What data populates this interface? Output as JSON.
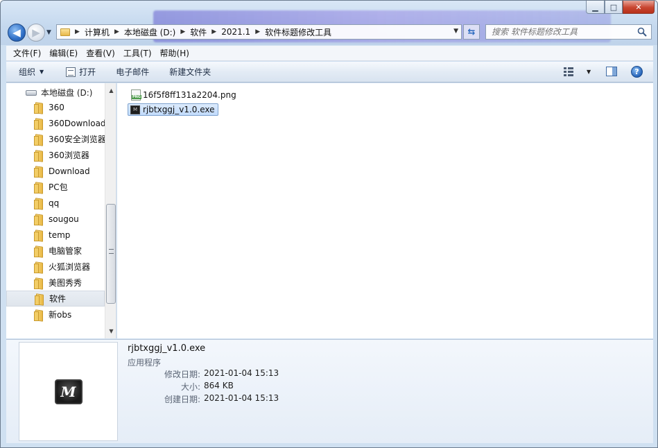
{
  "window": {
    "controls": {
      "minimize": "▁",
      "maximize": "□",
      "close": "✕"
    }
  },
  "nav": {
    "back_glyph": "◀",
    "forward_glyph": "▶",
    "address": [
      "计算机",
      "本地磁盘 (D:)",
      "软件",
      "2021.1",
      "软件标题修改工具"
    ],
    "search_placeholder": "搜索 软件标题修改工具"
  },
  "menubar": [
    "文件(F)",
    "编辑(E)",
    "查看(V)",
    "工具(T)",
    "帮助(H)"
  ],
  "commandbar": {
    "organize": "组织",
    "open": "打开",
    "email": "电子邮件",
    "new_folder": "新建文件夹"
  },
  "navpane": {
    "drive": "本地磁盘 (D:)",
    "folders": [
      "360",
      "360Download",
      "360安全浏览器",
      "360浏览器",
      "Download",
      "PC包",
      "qq",
      "sougou",
      "temp",
      "电脑管家",
      "火狐浏览器",
      "美图秀秀",
      "软件",
      "新obs"
    ],
    "selected_folder": "软件"
  },
  "files": [
    {
      "name": "16f5f8ff131a2204.png",
      "type": "png",
      "selected": false
    },
    {
      "name": "rjbtxggj_v1.0.exe",
      "type": "exe",
      "selected": true
    }
  ],
  "details": {
    "name": "rjbtxggj_v1.0.exe",
    "type": "应用程序",
    "rows": [
      {
        "label": "修改日期:",
        "value": "2021-01-04 15:13"
      },
      {
        "label": "大小:",
        "value": "864 KB"
      },
      {
        "label": "创建日期:",
        "value": "2021-01-04 15:13"
      }
    ],
    "thumbnail_glyph": "M"
  },
  "icons": [
    "folder-icon",
    "drive-icon",
    "search-icon",
    "refresh-icon",
    "views-icon",
    "preview-pane-icon",
    "help-icon",
    "png-file-icon",
    "exe-file-icon"
  ]
}
